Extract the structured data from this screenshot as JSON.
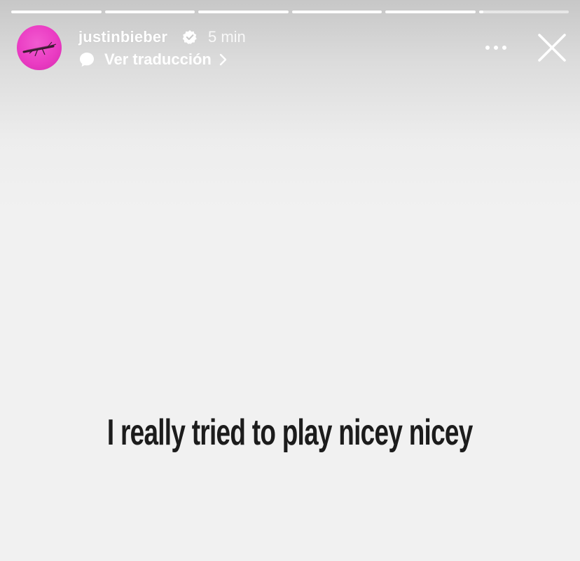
{
  "story": {
    "progress_segments": [
      1,
      1,
      1,
      1,
      1,
      0.05
    ],
    "author": {
      "username": "justinbieber",
      "verified": true,
      "time_ago": "5 min"
    },
    "translate": {
      "label": "Ver traducción"
    },
    "caption": "I really tried to play nicey nicey"
  },
  "icons": {
    "verified": "verified-badge-icon",
    "translate": "speech-bubble-icon",
    "chevron": "chevron-right-icon",
    "more": "more-options-icon",
    "close": "close-icon"
  },
  "colors": {
    "avatar_background": "#ea3cc3",
    "caption_text": "#1c1c1c",
    "header_text": "#ffffff"
  }
}
